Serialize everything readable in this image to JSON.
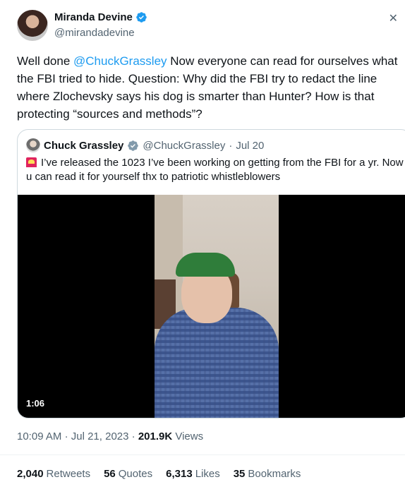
{
  "author": {
    "name": "Miranda Devine",
    "handle": "@mirandadevine"
  },
  "tweet": {
    "prefix": "Well done ",
    "mention": "@ChuckGrassley",
    "body": " Now everyone can read for ourselves what the FBI tried to hide. Question: Why did the FBI try to redact the line where Zlochevsky says his dog is smarter than Hunter? How is that protecting “sources and methods”?"
  },
  "quote": {
    "name": "Chuck Grassley",
    "handle": "@ChuckGrassley",
    "separator": "·",
    "date": "Jul 20",
    "text": "I’ve released the 1023 I’ve been working on getting from the FBI for a yr. Now u can read it for yourself thx to patriotic whistleblowers",
    "video_duration": "1:06"
  },
  "meta": {
    "time": "10:09 AM",
    "date": "Jul 21, 2023",
    "views_count": "201.9K",
    "views_label": "Views"
  },
  "stats": {
    "retweets_count": "2,040",
    "retweets_label": "Retweets",
    "quotes_count": "56",
    "quotes_label": "Quotes",
    "likes_count": "6,313",
    "likes_label": "Likes",
    "bookmarks_count": "35",
    "bookmarks_label": "Bookmarks"
  },
  "colors": {
    "link": "#1d9bf0",
    "muted": "#536471",
    "text": "#0f1419",
    "border": "#cfd9de"
  },
  "icons": [
    "verified-badge-icon",
    "close-icon",
    "siren-icon"
  ]
}
